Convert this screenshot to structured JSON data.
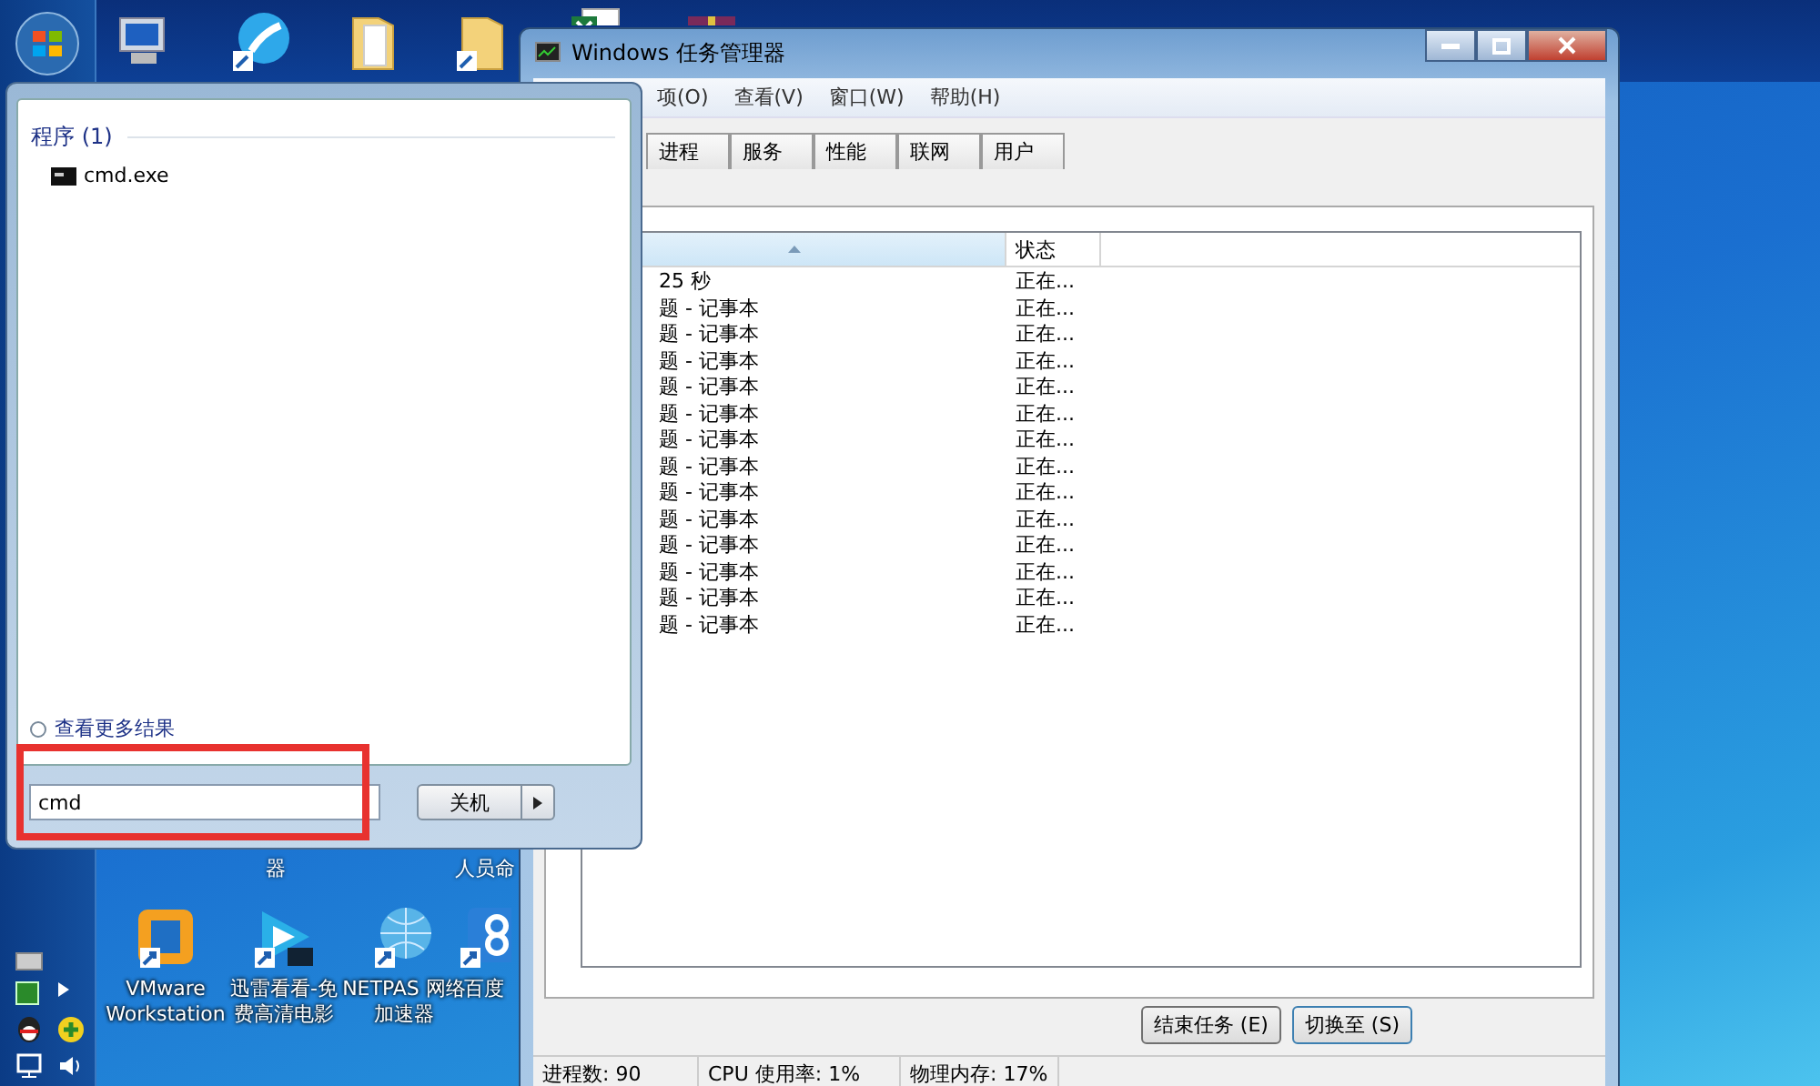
{
  "start_menu": {
    "section_title": "程序 (1)",
    "results": [
      {
        "label": "cmd.exe"
      }
    ],
    "more_results": "查看更多结果",
    "search": {
      "value": "cmd"
    },
    "shutdown_button": "关机"
  },
  "task_manager": {
    "title": "Windows 任务管理器",
    "menu": [
      "项(O)",
      "查看(V)",
      "窗口(W)",
      "帮助(H)"
    ],
    "tabs": [
      {
        "label": "进程",
        "selected": false
      },
      {
        "label": "服务",
        "selected": false
      },
      {
        "label": "性能",
        "selected": false
      },
      {
        "label": "联网",
        "selected": false
      },
      {
        "label": "用户",
        "selected": false
      }
    ],
    "status_column": "状态",
    "rows": [
      {
        "task": "25 秒",
        "status": "正在..."
      },
      {
        "task": "题 - 记事本",
        "status": "正在..."
      },
      {
        "task": "题 - 记事本",
        "status": "正在..."
      },
      {
        "task": "题 - 记事本",
        "status": "正在..."
      },
      {
        "task": "题 - 记事本",
        "status": "正在..."
      },
      {
        "task": "题 - 记事本",
        "status": "正在..."
      },
      {
        "task": "题 - 记事本",
        "status": "正在..."
      },
      {
        "task": "题 - 记事本",
        "status": "正在..."
      },
      {
        "task": "题 - 记事本",
        "status": "正在..."
      },
      {
        "task": "题 - 记事本",
        "status": "正在..."
      },
      {
        "task": "题 - 记事本",
        "status": "正在..."
      },
      {
        "task": "题 - 记事本",
        "status": "正在..."
      },
      {
        "task": "题 - 记事本",
        "status": "正在..."
      },
      {
        "task": "题 - 记事本",
        "status": "正在..."
      }
    ],
    "buttons": [
      "结束任务 (E)",
      "切换至 (S)"
    ],
    "status_bar": [
      "进程数: 90",
      "CPU 使用率: 1%",
      "物理内存: 17%"
    ]
  },
  "desktop": {
    "label_fragments": [
      "器",
      "人员命"
    ],
    "icons": [
      {
        "kind": "vmware",
        "label": "VMware Workstation"
      },
      {
        "kind": "player",
        "label": "迅雷看看-免费高清电影"
      },
      {
        "kind": "globe",
        "label": "NETPAS 网络加速器"
      },
      {
        "kind": "cloud",
        "label": "百度"
      }
    ]
  }
}
